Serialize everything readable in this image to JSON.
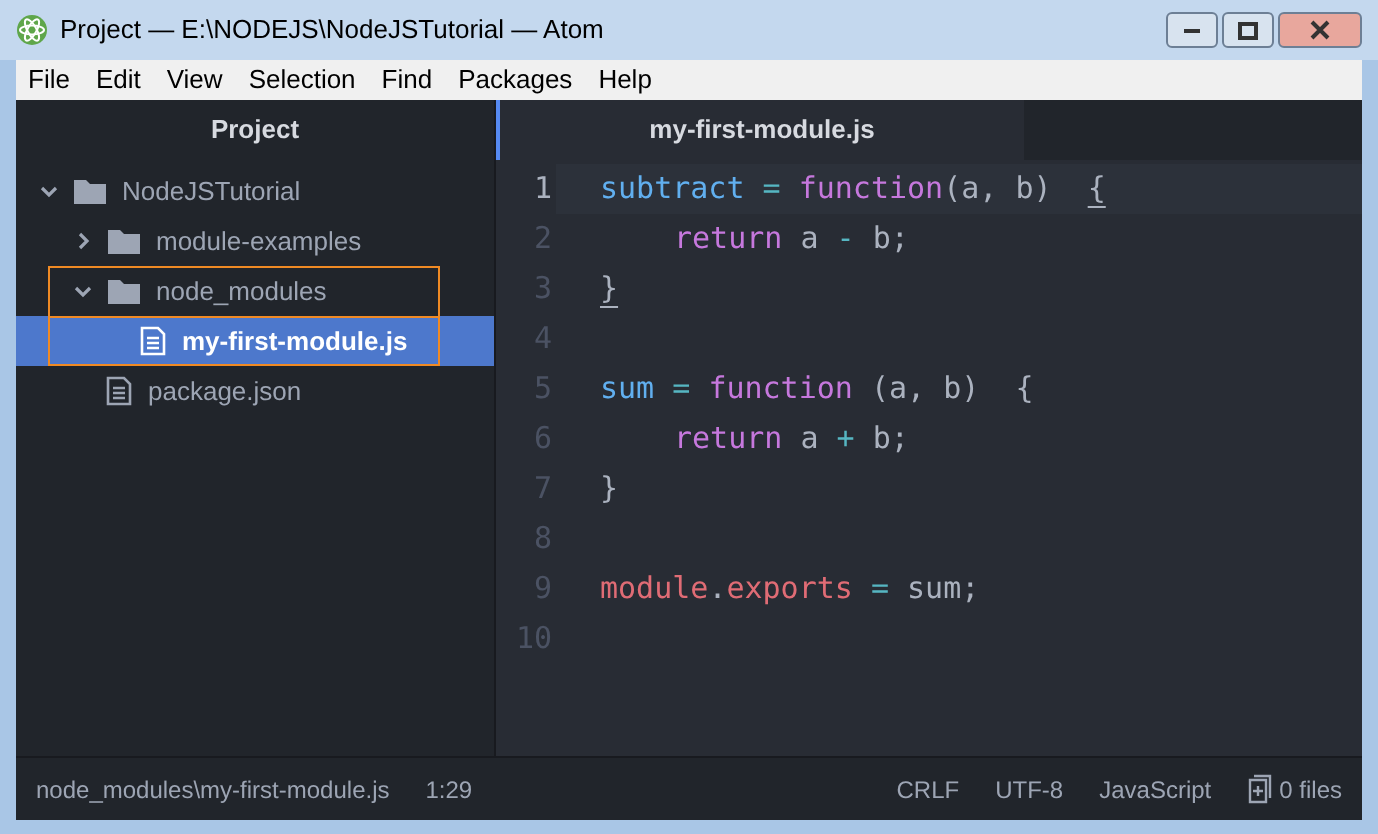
{
  "window": {
    "title": "Project — E:\\NODEJS\\NodeJSTutorial — Atom"
  },
  "menu": [
    "File",
    "Edit",
    "View",
    "Selection",
    "Find",
    "Packages",
    "Help"
  ],
  "tree_panel": {
    "title": "Project"
  },
  "tabs": [
    {
      "label": "my-first-module.js",
      "selected": true
    }
  ],
  "tree": [
    {
      "name": "NodeJSTutorial",
      "kind": "folder",
      "expanded": true,
      "selected": false,
      "outlined": false,
      "children": [
        {
          "name": "module-examples",
          "kind": "folder",
          "expanded": false,
          "selected": false,
          "outlined": false
        },
        {
          "name": "node_modules",
          "kind": "folder",
          "expanded": true,
          "selected": false,
          "outlined": true,
          "children": [
            {
              "name": "my-first-module.js",
              "kind": "file",
              "selected": true,
              "outlined": true
            }
          ]
        },
        {
          "name": "package.json",
          "kind": "file",
          "selected": false,
          "outlined": false
        }
      ]
    }
  ],
  "editor": {
    "lines": [
      {
        "number": "1",
        "current": true,
        "indented": false,
        "tokens": [
          {
            "text": "subtract",
            "kind": "variable"
          },
          {
            "text": " = ",
            "kind": "operator"
          },
          {
            "text": "function",
            "kind": "keyword"
          },
          {
            "text": "(a, b)  ",
            "kind": "plain"
          },
          {
            "text": "{",
            "kind": "bracket-match"
          }
        ]
      },
      {
        "number": "2",
        "current": false,
        "indented": true,
        "tokens": [
          {
            "text": "return",
            "kind": "keyword"
          },
          {
            "text": " a ",
            "kind": "plain"
          },
          {
            "text": "-",
            "kind": "operator"
          },
          {
            "text": " b;",
            "kind": "plain"
          }
        ]
      },
      {
        "number": "3",
        "current": false,
        "indented": false,
        "tokens": [
          {
            "text": "}",
            "kind": "bracket-match"
          }
        ]
      },
      {
        "number": "4",
        "current": false
      },
      {
        "number": "5",
        "current": false,
        "indented": false,
        "tokens": [
          {
            "text": "sum",
            "kind": "variable"
          },
          {
            "text": " = ",
            "kind": "operator"
          },
          {
            "text": "function",
            "kind": "keyword"
          },
          {
            "text": " (a, b)  {",
            "kind": "plain"
          }
        ]
      },
      {
        "number": "6",
        "current": false,
        "indented": true,
        "tokens": [
          {
            "text": "return",
            "kind": "keyword"
          },
          {
            "text": " a ",
            "kind": "plain"
          },
          {
            "text": "+",
            "kind": "operator"
          },
          {
            "text": " b;",
            "kind": "plain"
          }
        ]
      },
      {
        "number": "7",
        "current": false,
        "indented": false,
        "tokens": [
          {
            "text": "}",
            "kind": "plain"
          }
        ]
      },
      {
        "number": "8",
        "current": false
      },
      {
        "number": "9",
        "current": false,
        "indented": false,
        "tokens": [
          {
            "text": "module",
            "kind": "property"
          },
          {
            "text": ".",
            "kind": "plain"
          },
          {
            "text": "exports",
            "kind": "property"
          },
          {
            "text": " = ",
            "kind": "operator"
          },
          {
            "text": "sum;",
            "kind": "plain"
          }
        ]
      },
      {
        "number": "10",
        "current": false
      }
    ]
  },
  "status_bar": {
    "path": "node_modules\\my-first-module.js",
    "cursor": "1:29",
    "line_ending": "CRLF",
    "encoding": "UTF-8",
    "grammar": "JavaScript",
    "files": "0 files"
  }
}
